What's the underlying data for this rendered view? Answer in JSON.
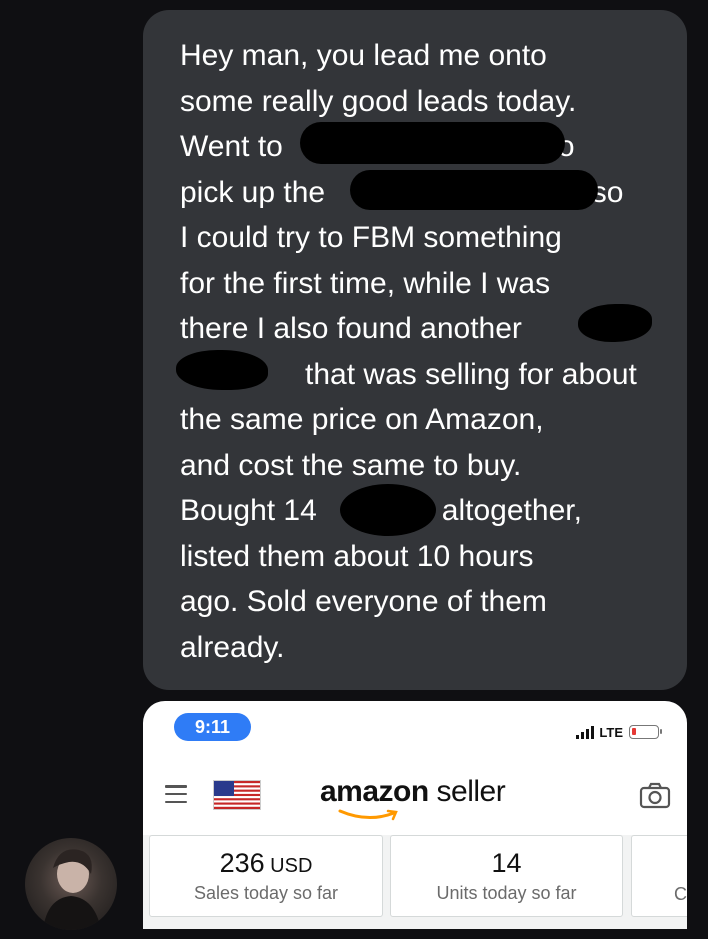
{
  "message": {
    "lines": [
      "Hey man, you lead me onto",
      "some really good leads today.",
      "Went to                                to",
      "pick up the                              , so",
      "I could try to FBM something",
      "for the first time, while I was",
      "there I also found another",
      "               that was selling for about",
      "the same price on Amazon,",
      "and cost the same to buy.",
      "Bought 14               altogether,",
      "listed them about 10 hours",
      "ago. Sold everyone of them",
      "already."
    ]
  },
  "screenshot": {
    "status_bar": {
      "time": "9:11",
      "network": "LTE"
    },
    "nav": {
      "brand": "amazon",
      "product": " seller"
    },
    "tiles": [
      {
        "value": "236",
        "unit": " USD",
        "label": "Sales today so far"
      },
      {
        "value": "14",
        "unit": "",
        "label": "Units today so far"
      },
      {
        "value": "",
        "unit": "",
        "label": "C"
      }
    ]
  },
  "colors": {
    "bubble": "#333539",
    "background": "#0f0f12",
    "status_pill": "#2f7cf6",
    "amazon_orange": "#ff9900"
  },
  "icons": [
    "menu-icon",
    "us-flag-icon",
    "amazon-smile-icon",
    "camera-icon",
    "signal-icon",
    "battery-icon"
  ]
}
